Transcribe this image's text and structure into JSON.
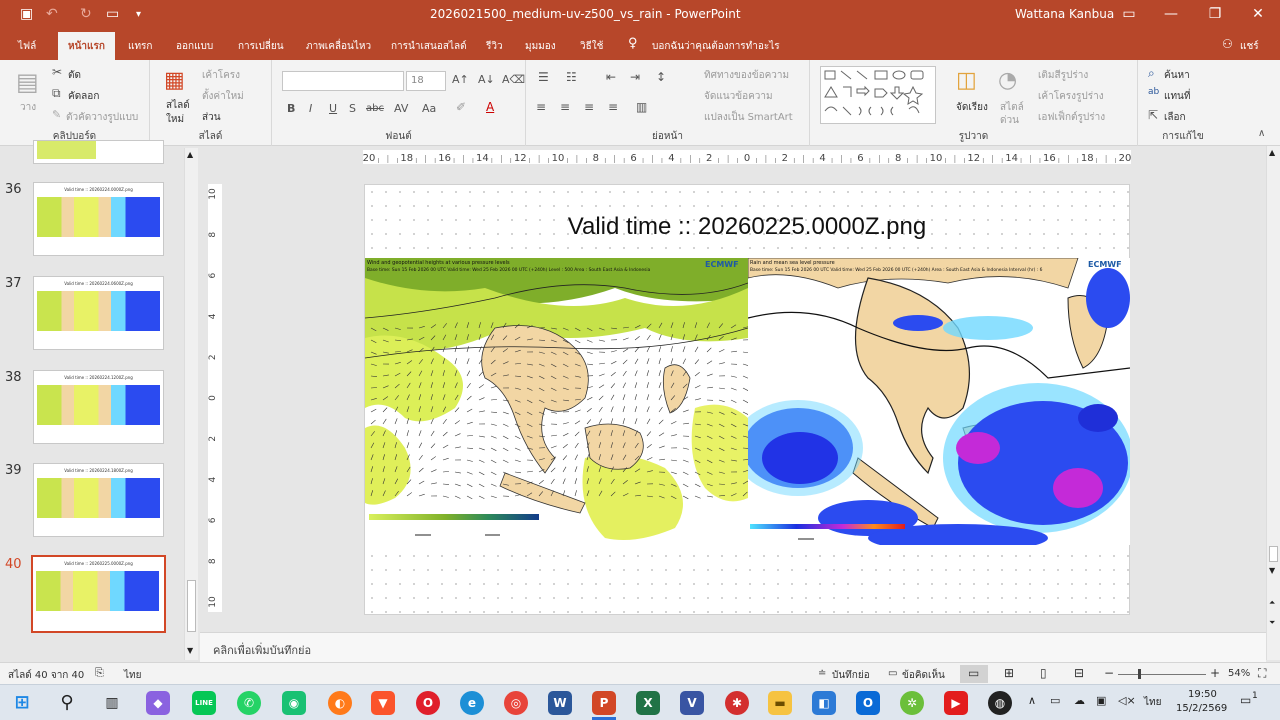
{
  "window": {
    "title": "2026021500_medium-uv-z500_vs_rain  -  PowerPoint",
    "user": "Wattana Kanbua"
  },
  "menu": {
    "items": [
      "ไฟล์",
      "หน้าแรก",
      "แทรก",
      "ออกแบบ",
      "การเปลี่ยน",
      "ภาพเคลื่อนไหว",
      "การนำเสนอสไลด์",
      "รีวิว",
      "มุมมอง",
      "วิธีใช้",
      "บอกฉันว่าคุณต้องการทำอะไร"
    ],
    "share": "แชร์"
  },
  "ribbon": {
    "clipboard": {
      "paste": "วาง",
      "cut": "ตัด",
      "copy": "คัดลอก",
      "format_painter": "ตัวคัดวางรูปแบบ",
      "label": "คลิปบอร์ด"
    },
    "slides": {
      "new_slide_1": "สไลด์",
      "new_slide_2": "ใหม่",
      "layout": "เค้าโครง",
      "reset": "ตั้งค่าใหม่",
      "section": "ส่วน",
      "label": "สไลด์"
    },
    "font": {
      "size": "18",
      "label": "ฟอนต์",
      "bold": "B",
      "italic": "I",
      "underline": "U",
      "strike": "S",
      "spacing": "abc"
    },
    "paragraph": {
      "text_direction": "ทิศทางของข้อความ",
      "align_text": "จัดแนวข้อความ",
      "smartart": "แปลงเป็น SmartArt",
      "label": "ย่อหน้า"
    },
    "drawing": {
      "arrange": "จัดเรียง",
      "quick_styles_1": "สไตล์",
      "quick_styles_2": "ด่วน",
      "fill": "เติมสีรูปร่าง",
      "outline": "เค้าโครงรูปร่าง",
      "effects": "เอฟเฟ็กต์รูปร่าง",
      "label": "รูปวาด"
    },
    "editing": {
      "find": "ค้นหา",
      "replace": "แทนที่",
      "select": "เลือก",
      "label": "การแก้ไข"
    }
  },
  "thumbnails": [
    {
      "num": "36",
      "title": "Valid time :: 20260224.0000Z.png"
    },
    {
      "num": "37",
      "title": "Valid time :: 20260224.0600Z.png"
    },
    {
      "num": "38",
      "title": "Valid time :: 20260224.1200Z.png"
    },
    {
      "num": "39",
      "title": "Valid time :: 20260224.1800Z.png"
    },
    {
      "num": "40",
      "title": "Valid time :: 20260225.0000Z.png"
    }
  ],
  "slide": {
    "title": "Valid time :: 20260225.0000Z.png",
    "left_map": {
      "heading": "Wind and geopotential heights at various pressure levels",
      "subheading": "Base time: Sun 15 Feb 2026 00 UTC Valid time: Wed 25 Feb 2026 00 UTC (+240h) Level : 500 Area : South East Asia & Indonesia",
      "logo": "ECMWF"
    },
    "right_map": {
      "heading": "Rain and mean sea level pressure",
      "subheading": "Base time: Sun 15 Feb 2026 00 UTC Valid time: Wed 25 Feb 2026 00 UTC (+240h) Area : South East Asia & Indonesia Interval (hr) : 6",
      "logo": "ECMWF"
    }
  },
  "rulers": {
    "h": [
      "20",
      "18",
      "16",
      "14",
      "12",
      "10",
      "8",
      "6",
      "4",
      "2",
      "0",
      "2",
      "4",
      "6",
      "8",
      "10",
      "12",
      "14",
      "16",
      "18",
      "20"
    ],
    "v": [
      "10",
      "8",
      "6",
      "4",
      "2",
      "0",
      "2",
      "4",
      "6",
      "8",
      "10"
    ]
  },
  "notes": {
    "placeholder": "คลิกเพื่อเพิ่มบันทึกย่อ"
  },
  "status": {
    "slide_count": "สไลด์ 40 จาก 40",
    "language": "ไทย",
    "notes": "บันทึกย่อ",
    "comments": "ข้อคิดเห็น",
    "zoom": "54%"
  },
  "taskbar": {
    "time": "19:50",
    "date": "15/2/2569",
    "lang": "ไทย",
    "notif": "1"
  }
}
